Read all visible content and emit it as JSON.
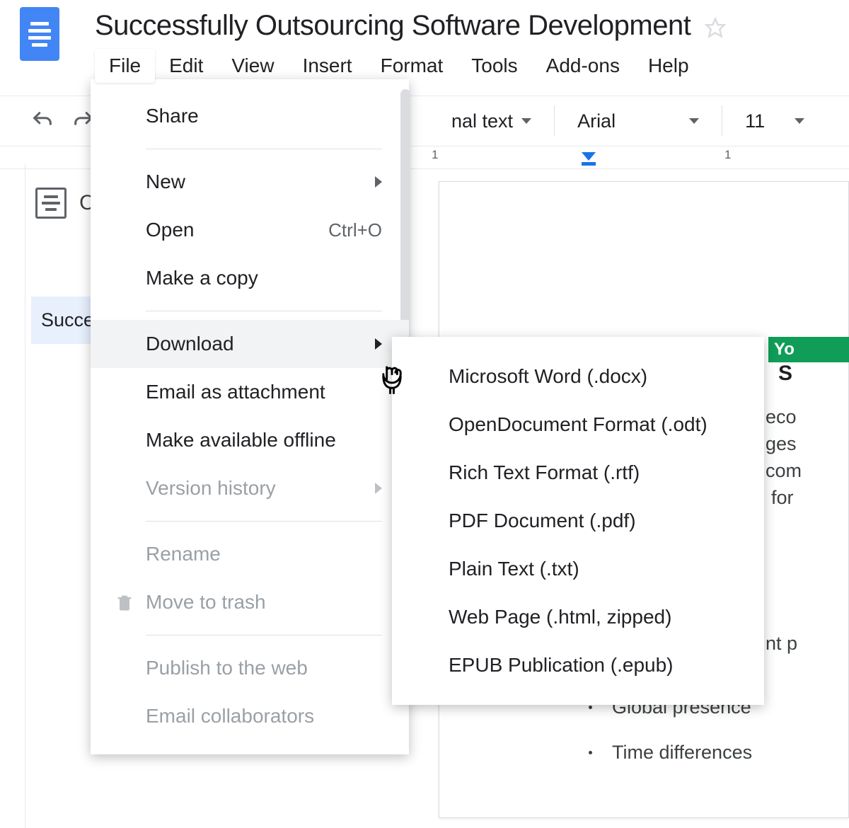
{
  "header": {
    "title": "Successfully Outsourcing Software Development"
  },
  "menubar": [
    "File",
    "Edit",
    "View",
    "Insert",
    "Format",
    "Tools",
    "Add-ons",
    "Help"
  ],
  "toolbar": {
    "styleDropdown": "nal text",
    "font": "Arial",
    "fontSize": "11"
  },
  "ruler": {
    "n1": "1",
    "n2": "1"
  },
  "outline": {
    "c_label": "C",
    "item1": "Succe"
  },
  "fileMenu": {
    "share": "Share",
    "new": "New",
    "open": "Open",
    "open_shortcut": "Ctrl+O",
    "makeCopy": "Make a copy",
    "download": "Download",
    "emailAttachment": "Email as attachment",
    "offline": "Make available offline",
    "versionHistory": "Version history",
    "rename": "Rename",
    "moveToTrash": "Move to trash",
    "publish": "Publish to the web",
    "emailCollab": "Email collaborators"
  },
  "downloadMenu": {
    "docx": "Microsoft Word (.docx)",
    "odt": "OpenDocument Format (.odt)",
    "rtf": "Rich Text Format (.rtf)",
    "pdf": "PDF Document (.pdf)",
    "txt": "Plain Text (.txt)",
    "html": "Web Page (.html, zipped)",
    "epub": "EPUB Publication (.epub)"
  },
  "docBody": {
    "badge": "Yo",
    "s": "S",
    "p1": "eco",
    "p2": "ges",
    "p3": "com",
    "p4": "for",
    "p5": "nt p",
    "b1": "Global presence",
    "b2": "Time differences"
  }
}
